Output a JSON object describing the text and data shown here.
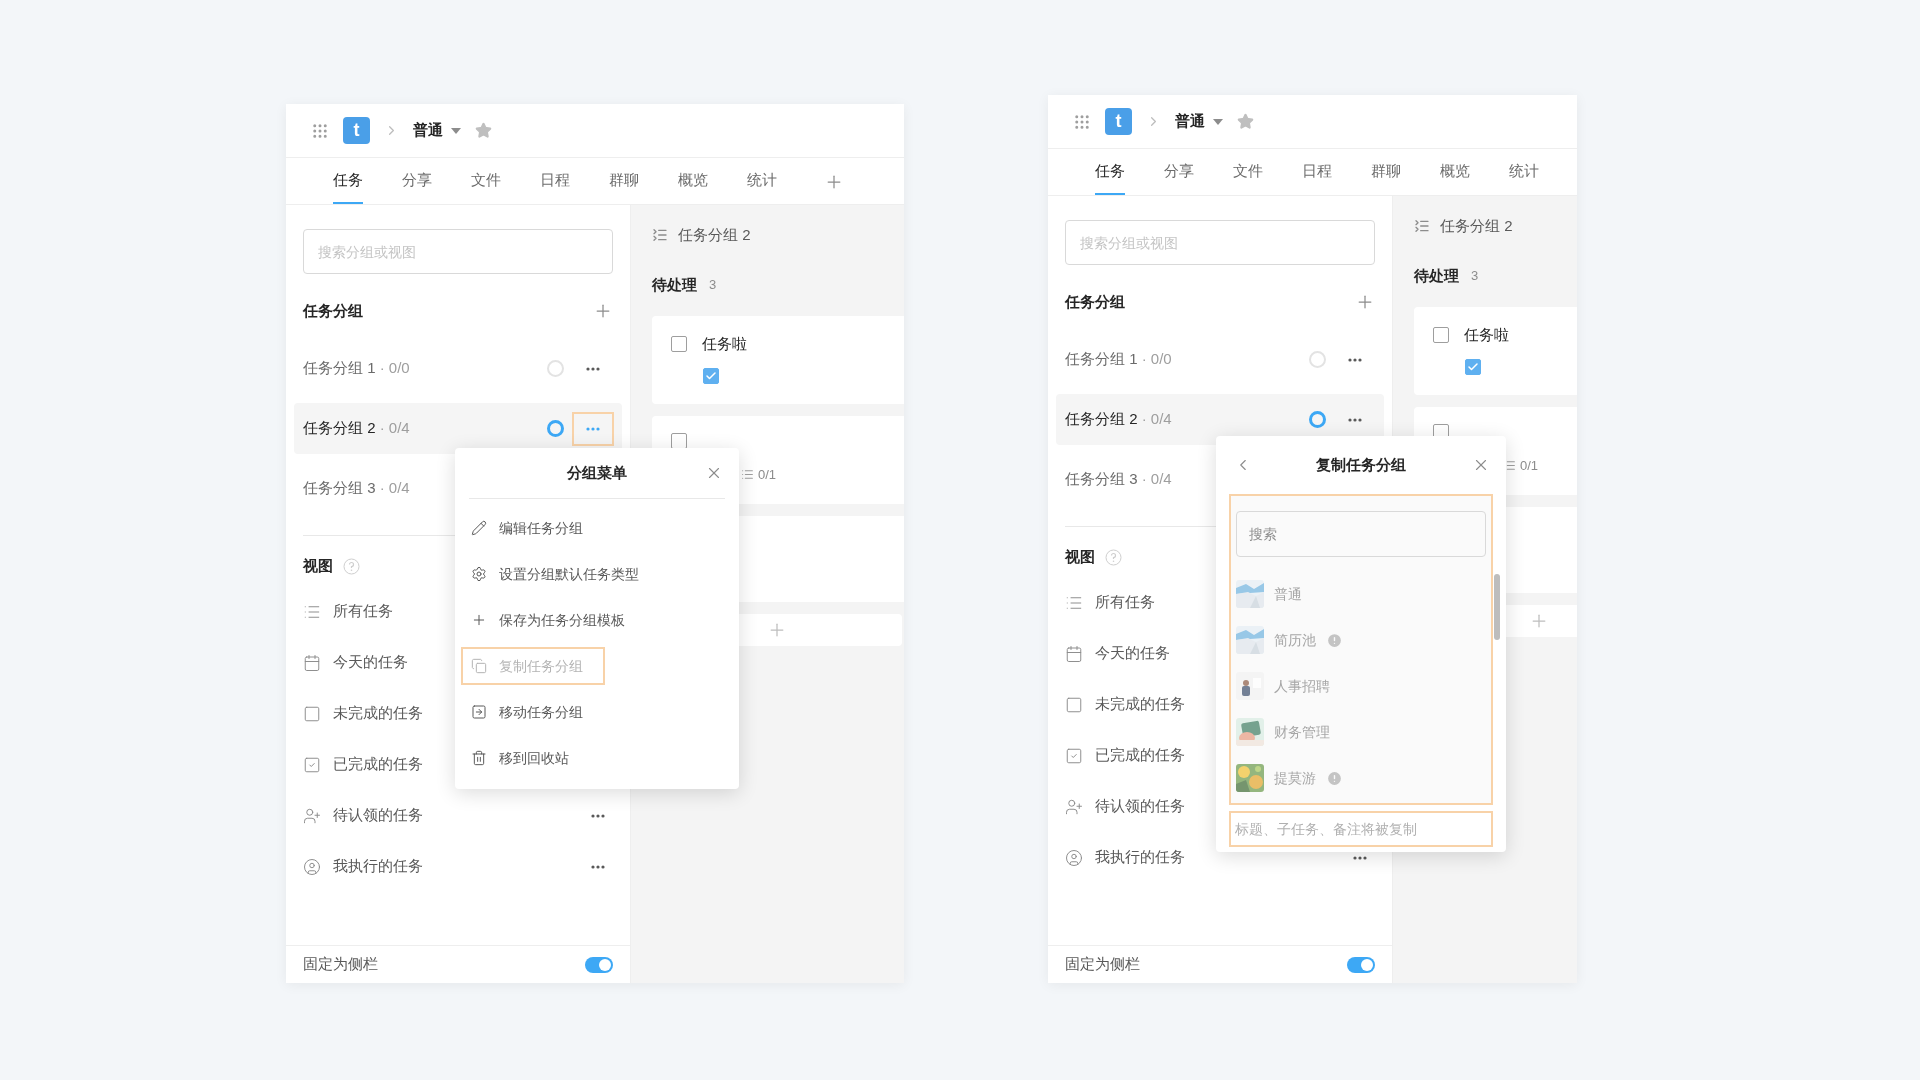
{
  "screens": [
    {
      "header": {
        "logo": "t",
        "project": "普通"
      },
      "tabs": [
        {
          "label": "任务",
          "selected": true
        },
        {
          "label": "分享",
          "selected": false
        },
        {
          "label": "文件",
          "selected": false
        },
        {
          "label": "日程",
          "selected": false
        },
        {
          "label": "群聊",
          "selected": false
        },
        {
          "label": "概览",
          "selected": false
        },
        {
          "label": "统计",
          "selected": false
        }
      ],
      "add_tab": true,
      "sidebar": {
        "search_placeholder": "搜索分组或视图",
        "groups_title": "任务分组",
        "groups": [
          {
            "name": "任务分组 1",
            "progress": "· 0/0",
            "selected": false,
            "highlighted": false
          },
          {
            "name": "任务分组 2",
            "progress": "· 0/4",
            "selected": true,
            "highlighted": true
          },
          {
            "name": "任务分组 3",
            "progress": "· 0/4",
            "selected": false
          }
        ],
        "views_title": "视图",
        "views": [
          {
            "kind": "list",
            "label": "所有任务"
          },
          {
            "kind": "calendar",
            "label": "今天的任务"
          },
          {
            "kind": "unchecked",
            "label": "未完成的任务"
          },
          {
            "kind": "checked",
            "label": "已完成的任务"
          },
          {
            "kind": "person-add",
            "label": "待认领的任务",
            "more": true
          },
          {
            "kind": "person-circle",
            "label": "我执行的任务",
            "more": true
          }
        ],
        "pin": {
          "label": "固定为侧栏",
          "on": true
        }
      },
      "board": {
        "title": "任务分组 2",
        "column": "待处理",
        "count": "3",
        "cards": [
          {
            "kind": "task",
            "title": "任务啦",
            "checked": false,
            "sub_checked": true
          },
          {
            "kind": "task",
            "checked": false,
            "subtasks": "0/1"
          },
          {
            "kind": "empty"
          }
        ]
      },
      "popup": {
        "kind": "menu",
        "title": "分组菜单",
        "items": [
          {
            "kind": "pencil",
            "label": "编辑任务分组",
            "disabled": false,
            "highlighted": false
          },
          {
            "kind": "gear",
            "label": "设置分组默认任务类型",
            "disabled": false,
            "highlighted": false
          },
          {
            "kind": "plus",
            "label": "保存为任务分组模板",
            "disabled": false,
            "highlighted": false
          },
          {
            "kind": "copy",
            "label": "复制任务分组",
            "disabled": true,
            "highlighted": true
          },
          {
            "kind": "move",
            "label": "移动任务分组",
            "disabled": false,
            "highlighted": false
          },
          {
            "kind": "trash",
            "label": "移到回收站",
            "disabled": false,
            "highlighted": false
          }
        ]
      }
    },
    {
      "header": {
        "logo": "t",
        "project": "普通"
      },
      "tabs": [
        {
          "label": "任务",
          "selected": true
        },
        {
          "label": "分享",
          "selected": false
        },
        {
          "label": "文件",
          "selected": false
        },
        {
          "label": "日程",
          "selected": false
        },
        {
          "label": "群聊",
          "selected": false
        },
        {
          "label": "概览",
          "selected": false
        },
        {
          "label": "统计",
          "selected": false
        }
      ],
      "sidebar": {
        "search_placeholder": "搜索分组或视图",
        "groups_title": "任务分组",
        "groups": [
          {
            "name": "任务分组 1",
            "progress": "· 0/0",
            "selected": false
          },
          {
            "name": "任务分组 2",
            "progress": "· 0/4",
            "selected": true
          },
          {
            "name": "任务分组 3",
            "progress": "· 0/4",
            "selected": false
          }
        ],
        "views_title": "视图",
        "views": [
          {
            "kind": "list",
            "label": "所有任务"
          },
          {
            "kind": "calendar",
            "label": "今天的任务"
          },
          {
            "kind": "unchecked",
            "label": "未完成的任务"
          },
          {
            "kind": "checked",
            "label": "已完成的任务"
          },
          {
            "kind": "person-add",
            "label": "待认领的任务"
          },
          {
            "kind": "person-circle",
            "label": "我执行的任务",
            "more": true
          }
        ],
        "pin": {
          "label": "固定为侧栏",
          "on": true
        }
      },
      "board": {
        "title": "任务分组 2",
        "column": "待处理",
        "count": "3",
        "cards": [
          {
            "kind": "task",
            "title": "任务啦",
            "checked": false,
            "sub_checked": true
          },
          {
            "kind": "task",
            "checked": false,
            "subtasks": "0/1"
          },
          {
            "kind": "empty"
          }
        ]
      },
      "popup": {
        "kind": "copy",
        "title": "复制任务分组",
        "search_placeholder": "搜索",
        "highlighted": true,
        "projects": [
          {
            "name": "普通",
            "warning": false
          },
          {
            "name": "简历池",
            "warning": true
          },
          {
            "name": "人事招聘",
            "warning": false
          },
          {
            "name": "财务管理",
            "warning": false
          },
          {
            "name": "提莫游",
            "warning": true
          }
        ],
        "hint": "标题、子任务、备注将被复制"
      }
    }
  ]
}
